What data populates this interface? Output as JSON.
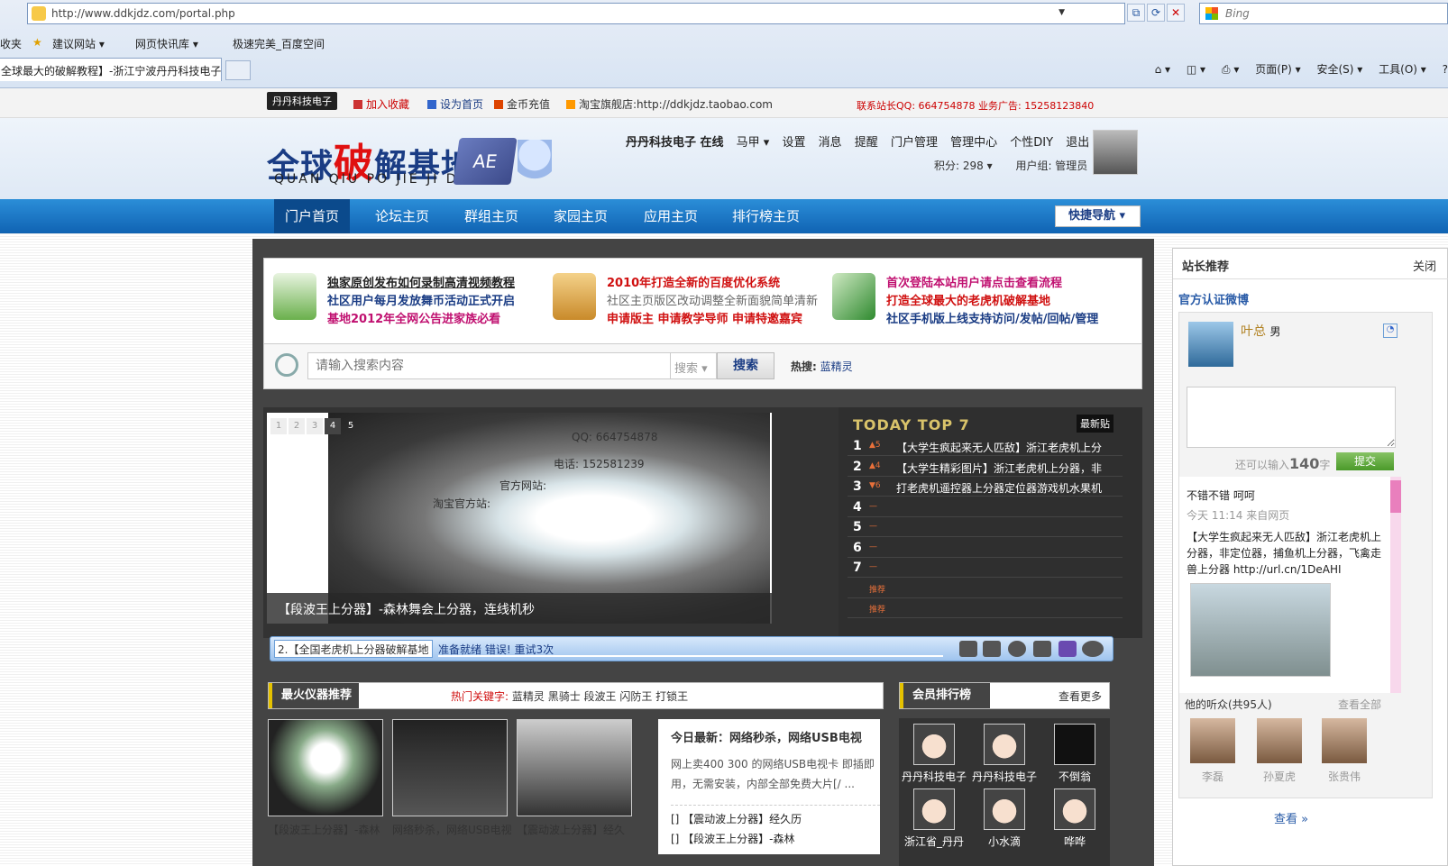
{
  "browser": {
    "url": "http://www.ddkjdz.com/portal.php",
    "search_placeholder": "Bing",
    "fav_cut": "收夹",
    "favorites": [
      "建议网站 ▾",
      "网页快讯库 ▾",
      "极速完美_百度空间"
    ],
    "tab_title": "全球最大的破解教程】-浙江宁波丹丹科技电子|...",
    "cmd": [
      "页面(P) ▾",
      "安全(S) ▾",
      "工具(O) ▾"
    ]
  },
  "topbar": {
    "brand": "丹丹科技电子",
    "links": [
      "加入收藏",
      "设为首页",
      "金币充值",
      "淘宝旗舰店:http://ddkjdz.taobao.com"
    ],
    "contact": "联系站长QQ: 664754878  业务广告: 15258123840"
  },
  "header": {
    "logo_main": "全球",
    "logo_red": "破",
    "logo_tail": "解基地",
    "logo_pinyin": "QUAN QIU PO JIE JI DI",
    "logo_ae": "AE",
    "user": [
      "丹丹科技电子 在线",
      "马甲 ▾",
      "设置",
      "消息",
      "提醒",
      "门户管理",
      "管理中心",
      "个性DIY",
      "退出"
    ],
    "points": "积分: 298 ▾",
    "group": "用户组: 管理员"
  },
  "nav": {
    "items": [
      "门户首页",
      "论坛主页",
      "群组主页",
      "家园主页",
      "应用主页",
      "排行榜主页"
    ],
    "quick": "快捷导航 ▾"
  },
  "announce": [
    [
      "独家原创发布如何录制高清视频教程",
      "社区用户每月发放舞币活动正式开启",
      "基地2012年全网公告进家族必看"
    ],
    [
      "2010年打造全新的百度优化系统",
      "社区主页版区改动调整全新面貌简单清新",
      "申请版主   申请教学导师   申请特邀嘉宾"
    ],
    [
      "首次登陆本站用户请点击查看流程",
      "打造全球最大的老虎机破解基地",
      "社区手机版上线支持访问/发帖/回帖/管理"
    ]
  ],
  "search": {
    "placeholder": "请输入搜索内容",
    "select": "搜索 ▾",
    "button": "搜索",
    "hot_label": "热搜:",
    "hot_word": "蓝精灵"
  },
  "slider": {
    "dots": [
      "1",
      "2",
      "3",
      "4",
      "5"
    ],
    "qq": "QQ: 664754878",
    "tel": "电话: 152581239",
    "site1": "官方网站:",
    "site2": "淘宝官方站:",
    "caption": "【段波王上分器】-森林舞会上分器，连线机秒"
  },
  "top7": {
    "title": "TODAY TOP 7",
    "latest": "最新贴",
    "rows": [
      {
        "n": "1",
        "ch": "▲5",
        "t": "【大学生疯起来无人匹敌】浙江老虎机上分"
      },
      {
        "n": "2",
        "ch": "▲4",
        "t": "【大学生精彩图片】浙江老虎机上分器，非"
      },
      {
        "n": "3",
        "ch": "▼6",
        "t": "打老虎机遥控器上分器定位器游戏机水果机"
      },
      {
        "n": "4",
        "ch": "—",
        "t": ""
      },
      {
        "n": "5",
        "ch": "—",
        "t": ""
      },
      {
        "n": "6",
        "ch": "—",
        "t": ""
      },
      {
        "n": "7",
        "ch": "—",
        "t": ""
      },
      {
        "n": "",
        "ch": "推荐",
        "t": ""
      },
      {
        "n": "",
        "ch": "推荐",
        "t": ""
      }
    ]
  },
  "player": {
    "track": "2.【全国老虎机上分器破解基地",
    "status": "准备就绪  错误! 重试3次"
  },
  "products": {
    "title": "最火仪器推荐",
    "kw_label": "热门关键字:",
    "keywords": "蓝精灵 黑骑士 段波王 闪防王 打锁王",
    "captions": [
      "【段波王上分器】-森林",
      "网络秒杀，网络USB电视",
      "【震动波上分器】经久"
    ],
    "news_title": "今日最新：网络秒杀，网络USB电视",
    "news_body": "网上卖400 300 的网络USB电视卡 即插即用，无需安装，内部全部免费大片[/ ...",
    "news_items": [
      "[] 【震动波上分器】经久历",
      "[] 【段波王上分器】-森林"
    ]
  },
  "members": {
    "title": "会员排行榜",
    "more": "查看更多",
    "list": [
      "丹丹科技电子",
      "丹丹科技电子",
      "不倒翁",
      "浙江省_丹丹",
      "小水滴",
      "哗哗"
    ]
  },
  "sidebar": {
    "title": "站长推荐",
    "close": "关闭",
    "weibo": "官方认证微博",
    "name": "叶总",
    "gender": "男",
    "left_prefix": "还可以输入",
    "left_num": "140",
    "left_suffix": "字",
    "submit": "提交",
    "post_head": "不错不错 呵呵",
    "post_time": "今天 11:14 来自网页",
    "post_body": "【大学生疯起来无人匹敌】浙江老虎机上分器，非定位器，捕鱼机上分器，飞禽走兽上分器 http://url.cn/1DeAHI",
    "fans": "他的听众(共95人)",
    "fans_all": "查看全部",
    "fan_names": [
      "李磊",
      "孙夏虎",
      "张贵伟"
    ],
    "see_more": "查看 »"
  },
  "colors": {
    "nav": "#1a78c6",
    "accent_red": "#d01010",
    "accent_blue": "#1a3c84",
    "link_pink": "#c01070"
  }
}
